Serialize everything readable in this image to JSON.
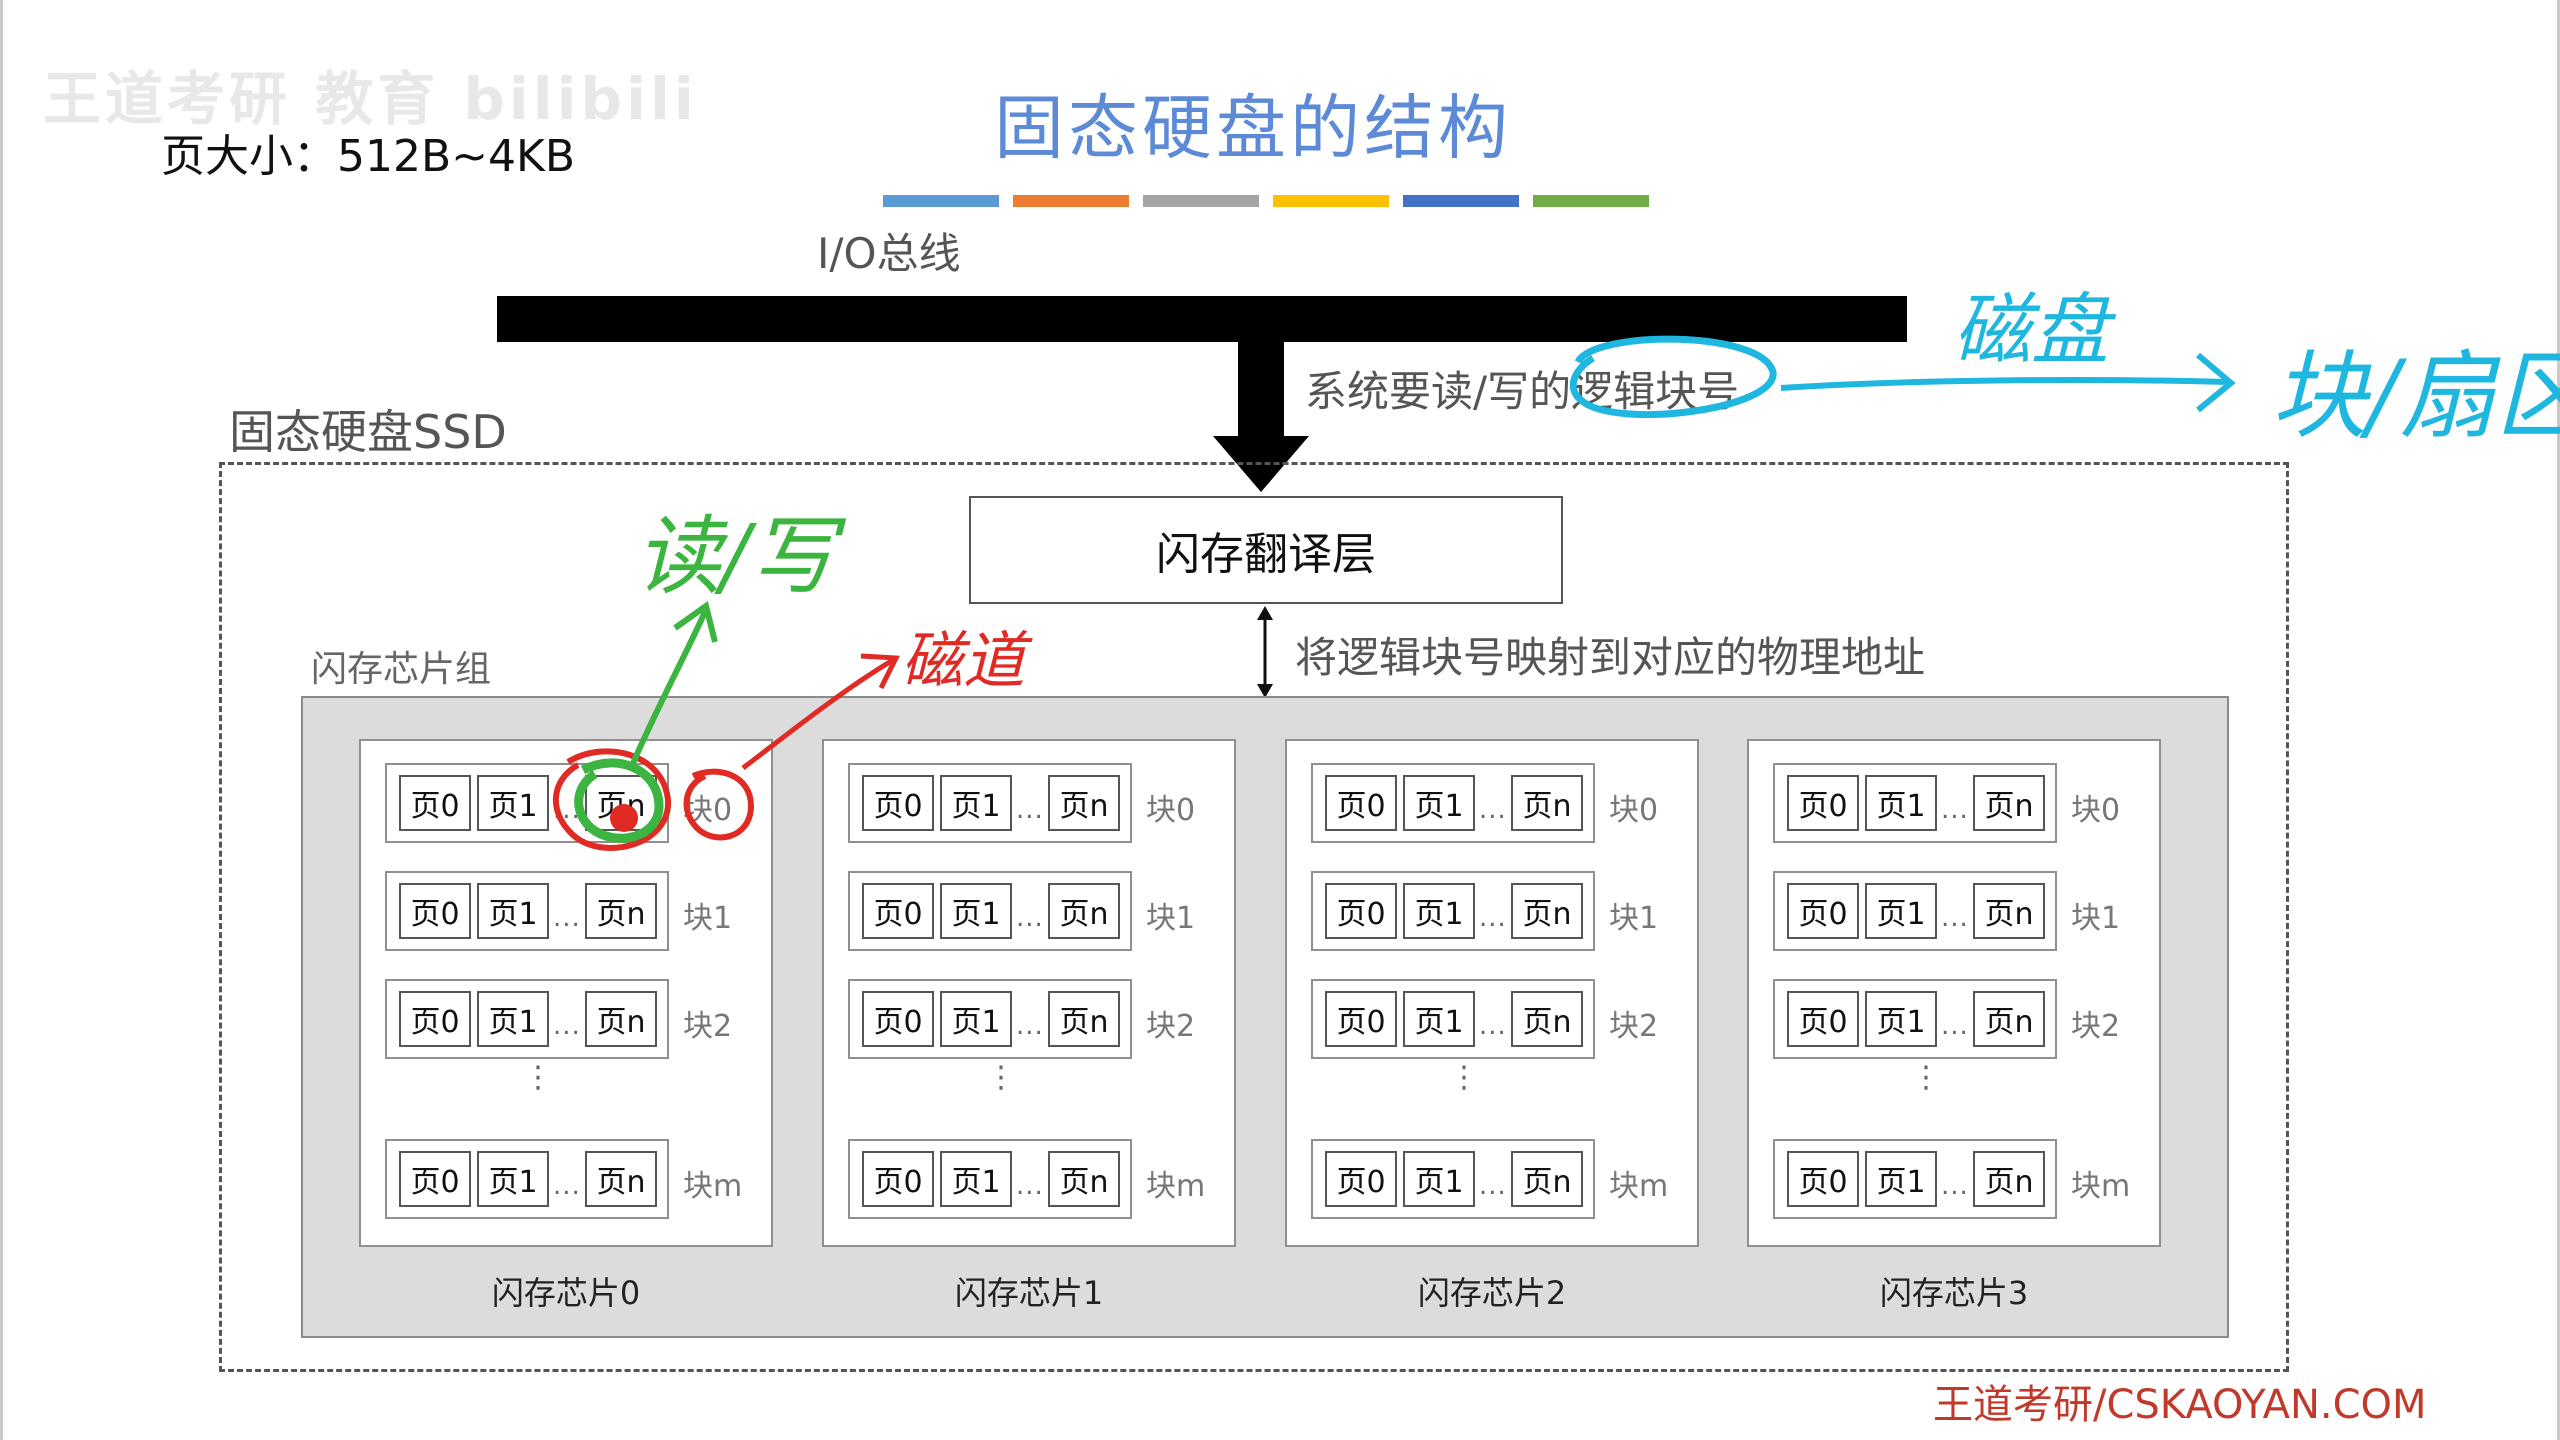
{
  "watermark": "王道考研 教育 bilibili",
  "page_size_note": "页大小：512B~4KB",
  "title": "固态硬盘的结构",
  "title_bar_colors": [
    "#5b9bd5",
    "#ed7d31",
    "#a5a5a5",
    "#ffc000",
    "#4472c4",
    "#70ad47"
  ],
  "io_bus": {
    "label": "I/O总线"
  },
  "read_write_label": "系统要读/写的逻辑块号",
  "ssd_label": "固态硬盘SSD",
  "ftl_label": "闪存翻译层",
  "mapping_label": "将逻辑块号映射到对应的物理地址",
  "flash_group_label": "闪存芯片组",
  "page_labels": {
    "p0": "页0",
    "p1": "页1",
    "pn": "页n",
    "dots": "..."
  },
  "block_labels": [
    "块0",
    "块1",
    "块2",
    "块m"
  ],
  "vertical_dots": "⋮",
  "chips": [
    {
      "label": "闪存芯片0"
    },
    {
      "label": "闪存芯片1"
    },
    {
      "label": "闪存芯片2"
    },
    {
      "label": "闪存芯片3"
    }
  ],
  "annotations": {
    "blue_disk": "磁盘",
    "blue_block": "块/扇区",
    "green_rw": "读/写",
    "red_track": "磁道",
    "colors": {
      "blue": "#1fb7e0",
      "green": "#3cb440",
      "red": "#e02a24"
    }
  },
  "footer": "王道考研/CSKAOYAN.COM"
}
